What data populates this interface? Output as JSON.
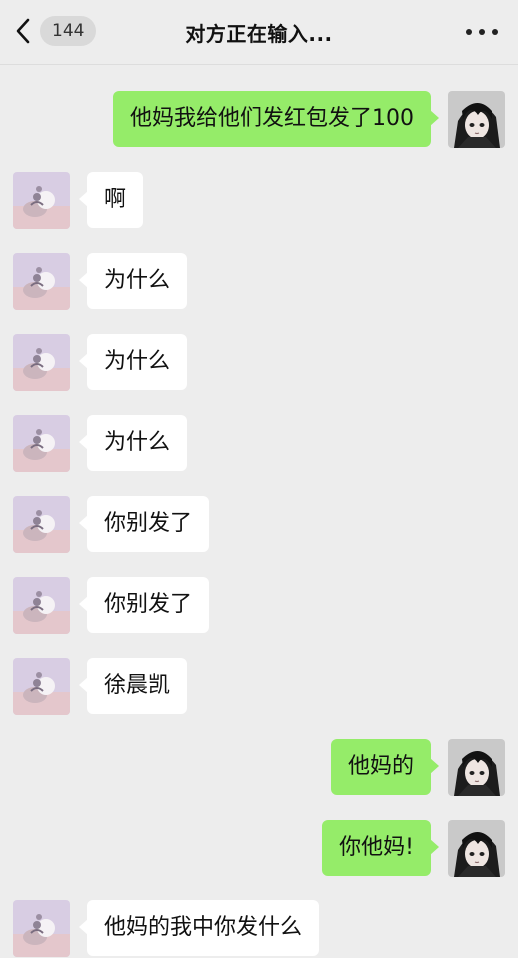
{
  "header": {
    "unread_count": "144",
    "title": "对方正在输入..."
  },
  "messages": [
    {
      "side": "right",
      "text": "他妈我给他们发红包发了100"
    },
    {
      "side": "left",
      "text": "啊"
    },
    {
      "side": "left",
      "text": "为什么"
    },
    {
      "side": "left",
      "text": "为什么"
    },
    {
      "side": "left",
      "text": "为什么"
    },
    {
      "side": "left",
      "text": " 你别发了"
    },
    {
      "side": "left",
      "text": "你别发了"
    },
    {
      "side": "left",
      "text": "徐晨凯"
    },
    {
      "side": "right",
      "text": "他妈的"
    },
    {
      "side": "right",
      "text": "你他妈!"
    },
    {
      "side": "left",
      "text": "他妈的我中你发什么"
    }
  ],
  "colors": {
    "background": "#ededed",
    "bubble_self": "#95ec69",
    "bubble_other": "#ffffff"
  }
}
